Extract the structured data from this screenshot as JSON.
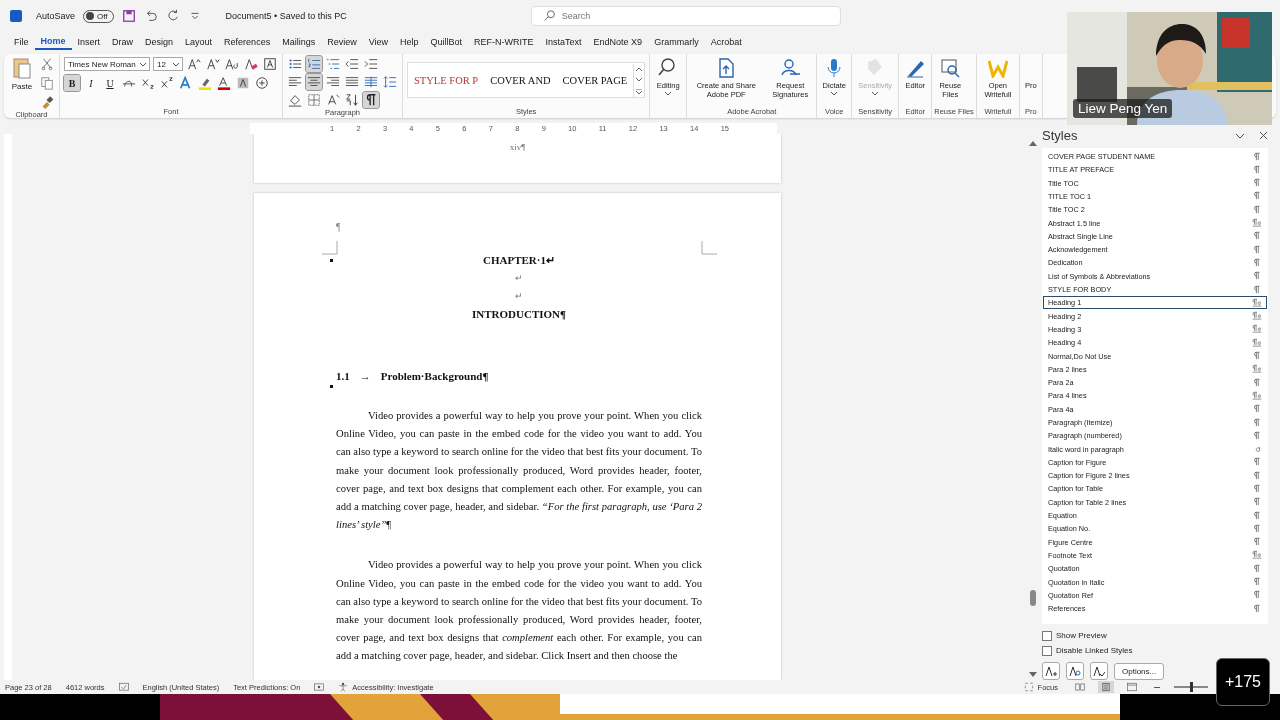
{
  "title_bar": {
    "autosave_label": "AutoSave",
    "autosave_on": false,
    "autosave_state": "Off",
    "document_title": "Document5 • Saved to this PC",
    "search_placeholder": "Search"
  },
  "tabs": [
    {
      "label": "File",
      "selected": false
    },
    {
      "label": "Home",
      "selected": true
    },
    {
      "label": "Insert",
      "selected": false
    },
    {
      "label": "Draw",
      "selected": false
    },
    {
      "label": "Design",
      "selected": false
    },
    {
      "label": "Layout",
      "selected": false
    },
    {
      "label": "References",
      "selected": false
    },
    {
      "label": "Mailings",
      "selected": false
    },
    {
      "label": "Review",
      "selected": false
    },
    {
      "label": "View",
      "selected": false
    },
    {
      "label": "Help",
      "selected": false
    },
    {
      "label": "QuillBot",
      "selected": false
    },
    {
      "label": "REF-N-WRITE",
      "selected": false
    },
    {
      "label": "InstaText",
      "selected": false
    },
    {
      "label": "EndNote X9",
      "selected": false
    },
    {
      "label": "Grammarly",
      "selected": false
    },
    {
      "label": "Acrobat",
      "selected": false
    }
  ],
  "ribbon": {
    "clipboard": {
      "paste_label": "Paste",
      "group_label": "Clipboard"
    },
    "font": {
      "font_name": "Times New Roman",
      "font_size": "12",
      "bold": true,
      "italic": false,
      "underline": false,
      "bold_label": "B",
      "italic_label": "I",
      "underline_label": "U",
      "group_label": "Font"
    },
    "paragraph": {
      "numbering_on": true,
      "align_center": true,
      "show_marks": true,
      "group_label": "Paragraph"
    },
    "styles": {
      "group_label": "Styles",
      "gallery": [
        {
          "label": "STYLE FOR P",
          "color": "#b03a3a"
        },
        {
          "label": "COVER AND",
          "color": "#111111"
        },
        {
          "label": "COVER PAGE",
          "color": "#111111"
        }
      ]
    },
    "command_groups": [
      {
        "buttons": [
          {
            "kind": "find",
            "label": "Editing",
            "dropdown": true,
            "disabled": false
          }
        ]
      },
      {
        "label": "Adobe Acrobat",
        "buttons": [
          {
            "kind": "pdf",
            "label": "Create and Share Adobe PDF",
            "dropdown": false,
            "disabled": false
          },
          {
            "kind": "signature",
            "label": "Request Signatures",
            "dropdown": false,
            "disabled": false
          }
        ]
      },
      {
        "label": "Voice",
        "buttons": [
          {
            "kind": "mic",
            "label": "Dictate",
            "dropdown": true,
            "disabled": false
          }
        ]
      },
      {
        "label": "Sensitivity",
        "buttons": [
          {
            "kind": "tag",
            "label": "Sensitivity",
            "dropdown": true,
            "disabled": true
          }
        ]
      },
      {
        "label": "Editor",
        "buttons": [
          {
            "kind": "pen",
            "label": "Editor",
            "dropdown": false,
            "disabled": false
          }
        ]
      },
      {
        "label": "Reuse Files",
        "buttons": [
          {
            "kind": "reuse",
            "label": "Reuse Files",
            "dropdown": false,
            "disabled": false
          }
        ]
      },
      {
        "label": "Writefull",
        "buttons": [
          {
            "kind": "writefull",
            "label": "Open Writefull",
            "dropdown": false,
            "disabled": false
          }
        ]
      },
      {
        "label": "Pro",
        "buttons": [
          {
            "kind": "blank",
            "label": "Pro",
            "dropdown": false,
            "disabled": false
          }
        ]
      }
    ]
  },
  "ruler": {
    "marks": [
      "1",
      "2",
      "3",
      "4",
      "5",
      "6",
      "7",
      "8",
      "9",
      "10",
      "11",
      "12",
      "13",
      "14",
      "15"
    ]
  },
  "document": {
    "footer_page_number": "xiv¶",
    "empty_mark": "¶",
    "chapter": "CHAPTER·1↵",
    "breaks": [
      "↵",
      "↵"
    ],
    "title": "INTRODUCTION¶",
    "section_number": "1.1",
    "section_arrow": "→",
    "section_title": "Problem·Background¶",
    "paragraphs": [
      "Video provides a powerful way to help you prove your point. When you click Online Video, you can paste in the embed code for the video you want to add. You can also type a keyword to search online for the video that best fits your document. To make your document look professionally produced, Word provides header, footer, cover page, and text box designs that complement each other. For example, you can add a matching cover page, header, and sidebar. *“For the first paragraph, use ‘Para 2 lines’ style”*¶",
      "Video provides a powerful way to help you prove your point. When you click Online Video, you can paste in the embed code for the video you want to add. You can also type a keyword to search online for the video that best fits your document. To make your document look professionally produced, Word provides header, footer, cover page, and text box designs that *complement* each other. For example, you can add a matching cover page, header, and sidebar. Click Insert and then choose the"
    ]
  },
  "styles_pane": {
    "title": "Styles",
    "items": [
      {
        "name": "COVER PAGE STUDENT NAME",
        "kind": "para",
        "selected": false
      },
      {
        "name": "TITLE AT PREFACE",
        "kind": "para",
        "selected": false
      },
      {
        "name": "Title TOC",
        "kind": "para",
        "selected": false
      },
      {
        "name": "TITLE TOC 1",
        "kind": "para",
        "selected": false
      },
      {
        "name": "Title TOC 2",
        "kind": "para",
        "selected": false
      },
      {
        "name": "Abstract 1.5 line",
        "kind": "linked",
        "selected": false
      },
      {
        "name": "Abstract Single Line",
        "kind": "para",
        "selected": false
      },
      {
        "name": "Acknowledgement",
        "kind": "para",
        "selected": false
      },
      {
        "name": "Dedication",
        "kind": "para",
        "selected": false
      },
      {
        "name": "List of Symbols & Abbreviations",
        "kind": "para",
        "selected": false
      },
      {
        "name": "STYLE FOR BODY",
        "kind": "para",
        "selected": false
      },
      {
        "name": "Heading 1",
        "kind": "linked",
        "selected": true
      },
      {
        "name": "Heading 2",
        "kind": "linked",
        "selected": false
      },
      {
        "name": "Heading 3",
        "kind": "linked",
        "selected": false
      },
      {
        "name": "Heading 4",
        "kind": "linked",
        "selected": false
      },
      {
        "name": "Normal,Do Not Use",
        "kind": "para",
        "selected": false
      },
      {
        "name": "Para 2 lines",
        "kind": "linked",
        "selected": false
      },
      {
        "name": "Para 2a",
        "kind": "para",
        "selected": false
      },
      {
        "name": "Para 4 lines",
        "kind": "linked",
        "selected": false
      },
      {
        "name": "Para 4a",
        "kind": "para",
        "selected": false
      },
      {
        "name": "Paragraph (Itemize)",
        "kind": "para",
        "selected": false
      },
      {
        "name": "Paragraph (numbered)",
        "kind": "para",
        "selected": false
      },
      {
        "name": "Italic word in paragraph",
        "kind": "char",
        "selected": false
      },
      {
        "name": "Caption for Figure",
        "kind": "para",
        "selected": false
      },
      {
        "name": "Caption for Figure 2 lines",
        "kind": "para",
        "selected": false
      },
      {
        "name": "Caption for Table",
        "kind": "para",
        "selected": false
      },
      {
        "name": "Caption for Table 2 lines",
        "kind": "para",
        "selected": false
      },
      {
        "name": "Equation",
        "kind": "para",
        "selected": false
      },
      {
        "name": "Equation No.",
        "kind": "para",
        "selected": false
      },
      {
        "name": "Figure Centre",
        "kind": "para",
        "selected": false
      },
      {
        "name": "Footnote Text",
        "kind": "linked",
        "selected": false
      },
      {
        "name": "Quotation",
        "kind": "para",
        "selected": false
      },
      {
        "name": "Quotation in Italic",
        "kind": "para",
        "selected": false
      },
      {
        "name": "Quotation Ref",
        "kind": "para",
        "selected": false
      },
      {
        "name": "References",
        "kind": "para",
        "selected": false
      }
    ],
    "options": [
      {
        "label": "Show Preview",
        "checked": false
      },
      {
        "label": "Disable Linked Styles",
        "checked": false
      }
    ],
    "options_button": "Options..."
  },
  "status_bar": {
    "page": "Page 23 of 28",
    "words": "4612 words",
    "language": "English (United States)",
    "text_predictions": "Text Predictions: On",
    "accessibility": "Accessibility: Investigate",
    "focus": "Focus",
    "views": [
      {
        "kind": "read",
        "selected": false
      },
      {
        "kind": "print",
        "selected": true
      },
      {
        "kind": "web",
        "selected": false
      }
    ]
  },
  "video_overlay": {
    "kind": "picture",
    "name": "Liew Peng Yen"
  },
  "participants_badge": "+175"
}
